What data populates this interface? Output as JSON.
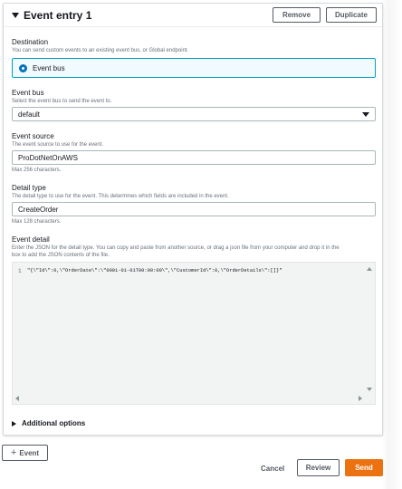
{
  "entry": {
    "title": "Event entry 1",
    "remove_label": "Remove",
    "duplicate_label": "Duplicate"
  },
  "destination": {
    "label": "Destination",
    "description": "You can send custom events to an existing event bus, or Global endpoint.",
    "option": "Event bus",
    "selected": true
  },
  "event_bus": {
    "label": "Event bus",
    "description": "Select the event bus to send the event to.",
    "value": "default"
  },
  "event_source": {
    "label": "Event source",
    "description": "The event source to use for the event.",
    "value": "ProDotNetOnAWS",
    "hint": "Max 256 characters."
  },
  "detail_type": {
    "label": "Detail type",
    "description": "The detail type to use for the event. This determines which fields are included in the event.",
    "value": "CreateOrder",
    "hint": "Max 128 characters."
  },
  "event_detail": {
    "label": "Event detail",
    "description_line1": "Enter the JSON for the detail type. You can copy and paste from another source, or drag a json file from your computer and drop it in the",
    "description_line2": "box to add the JSON contents of the file.",
    "line_number": "1",
    "code": "\"{\\\"Id\\\":0,\\\"OrderDate\\\":\\\"0001-01-01T00:00:00\\\",\\\"CustomerId\\\":0,\\\"OrderDetails\\\":[]}\""
  },
  "additional_options": "Additional options",
  "footer": {
    "add_event_label": "Event",
    "cancel_label": "Cancel",
    "review_label": "Review",
    "send_label": "Send"
  },
  "colors": {
    "accent": "#0073bb",
    "primary_button": "#ec7211",
    "selected_bg": "#f1faff"
  }
}
